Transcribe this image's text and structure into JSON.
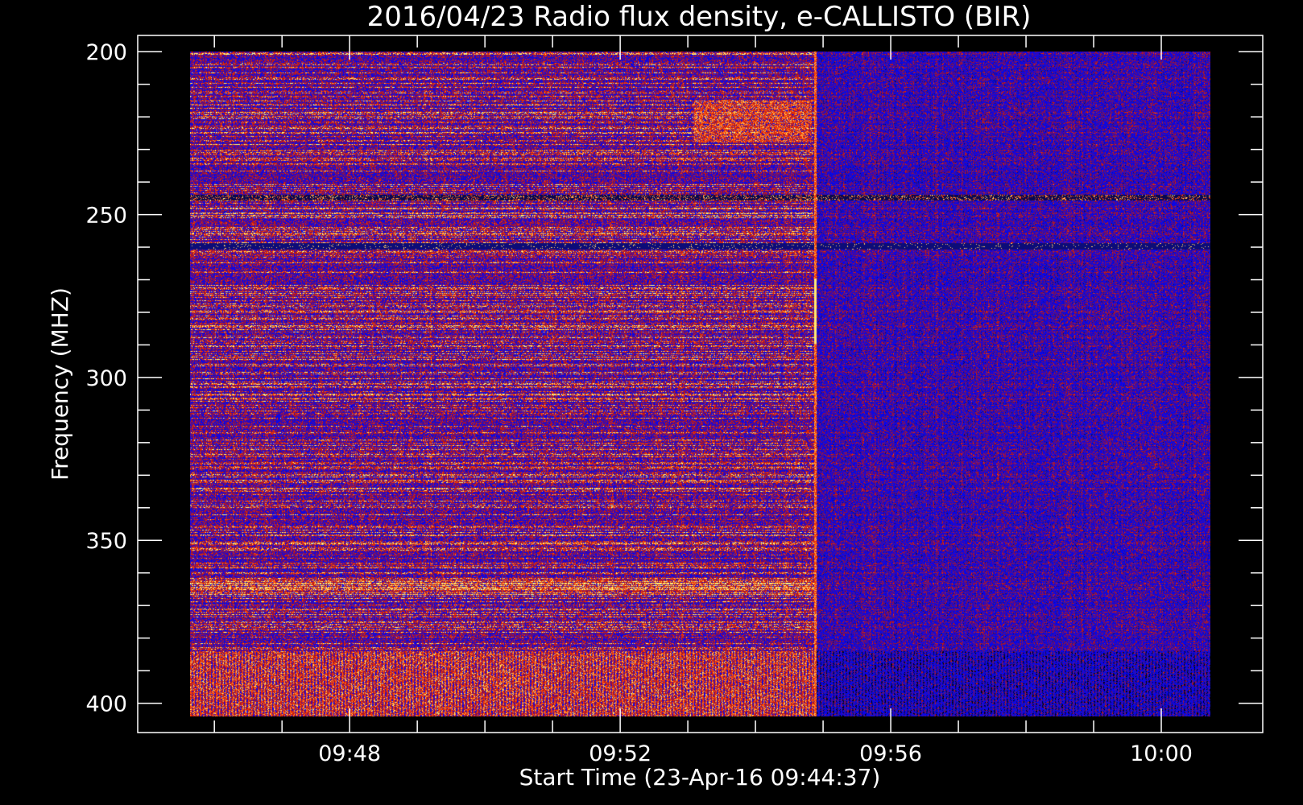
{
  "chart_data": {
    "type": "heatmap",
    "title": "2016/04/23  Radio flux density, e-CALLISTO (BIR)",
    "xlabel": "Start Time (23-Apr-16 09:44:37)",
    "ylabel": "Frequency (MHZ)",
    "x_range": [
      "09:45:30",
      "10:00:00"
    ],
    "xlim": [
      "09:44:52",
      "10:01:30"
    ],
    "x_ticks": [
      "09:48",
      "09:52",
      "09:56",
      "10:00"
    ],
    "y_range_mhz": [
      200,
      405
    ],
    "ylim": [
      195,
      409
    ],
    "y_ticks": [
      200,
      250,
      300,
      350,
      400
    ],
    "y_inverted": true,
    "colormap": [
      "#000000",
      "#1414c8",
      "#0000ff",
      "#b41414",
      "#ff3c00",
      "#ffff80"
    ],
    "features": [
      {
        "label": "sharp background change / vertical burst",
        "time": "09:54:23",
        "freq_range_mhz": [
          200,
          405
        ]
      },
      {
        "label": "emission patch",
        "time_range": [
          "09:52:40",
          "09:54:20"
        ],
        "freq_range_mhz": [
          215,
          228
        ]
      },
      {
        "label": "interference band",
        "freq_mhz": 245
      },
      {
        "label": "interference band",
        "freq_mhz": 260
      },
      {
        "label": "interference band",
        "freq_mhz": 365
      },
      {
        "label": "strong interference band",
        "freq_range_mhz": [
          385,
          405
        ]
      }
    ]
  }
}
